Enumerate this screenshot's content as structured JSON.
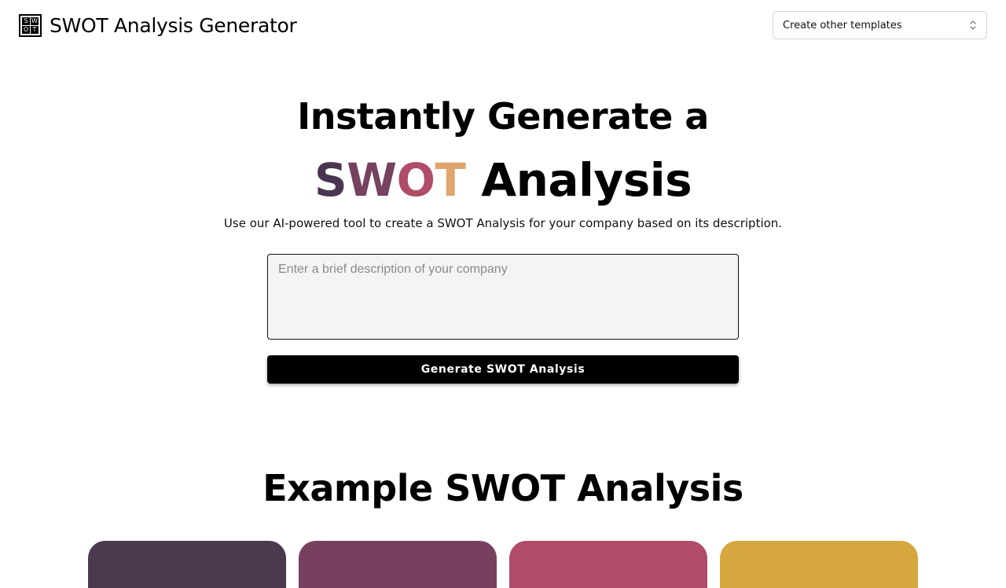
{
  "header": {
    "logo_letters": [
      "S",
      "W",
      "O",
      "T"
    ],
    "title": "SWOT Analysis Generator",
    "template_select": {
      "selected": "Create other templates",
      "icon": "chevron-updown-icon"
    }
  },
  "hero": {
    "line1": "Instantly Generate a",
    "swot_letters": [
      "S",
      "W",
      "O",
      "T"
    ],
    "swot_colors": [
      "#4a3550",
      "#76425f",
      "#b04c68",
      "#e0a56e"
    ],
    "line2_rest": "Analysis",
    "subtitle": "Use our AI-powered tool to create a SWOT Analysis for your company based on its description."
  },
  "form": {
    "description_value": "",
    "description_placeholder": "Enter a brief description of your company",
    "generate_label": "Generate SWOT Analysis"
  },
  "example": {
    "title": "Example SWOT Analysis",
    "card_colors": [
      "#4a3a4e",
      "#78405f",
      "#b04c68",
      "#d7a73f"
    ]
  }
}
